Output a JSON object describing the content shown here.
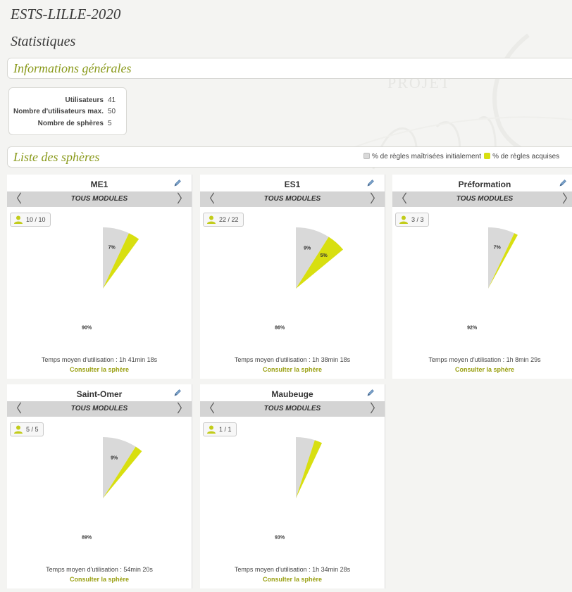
{
  "app_title": "ESTS-LILLE-2020",
  "page_title": "Statistiques",
  "general": {
    "title": "Informations générales",
    "rows": [
      {
        "label": "Utilisateurs",
        "value": "41"
      },
      {
        "label": "Nombre d'utilisateurs max.",
        "value": "50"
      },
      {
        "label": "Nombre de sphères",
        "value": "5"
      }
    ]
  },
  "spheres_section": {
    "title": "Liste des sphères",
    "legend": {
      "initial_label": "% de règles maîtrisées initialement",
      "acquired_label": "% de règles acquises"
    }
  },
  "colors": {
    "initial": "#d9d9d9",
    "acquired": "#d8df10",
    "remaining": "#ffffff",
    "accent": "#8a9a1c"
  },
  "watermark": {
    "text": "PROJET"
  },
  "icons": {
    "edit": "pencil-icon",
    "users": "user-icon",
    "prev": "chevron-left-icon",
    "next": "chevron-right-icon"
  },
  "cards": [
    {
      "name": "ME1",
      "module": "TOUS MODULES",
      "users": "10 / 10",
      "initial_pct": 7,
      "acquired_pct": 3,
      "labels": {
        "initial": "7%",
        "acquired": "",
        "remaining": "90%"
      },
      "usage": "Temps moyen d'utilisation : 1h 41min 18s",
      "consult": "Consulter la sphère"
    },
    {
      "name": "ES1",
      "module": "TOUS MODULES",
      "users": "22 / 22",
      "initial_pct": 9,
      "acquired_pct": 5,
      "labels": {
        "initial": "9%",
        "acquired": "5%",
        "remaining": "86%"
      },
      "usage": "Temps moyen d'utilisation : 1h 38min 18s",
      "consult": "Consulter la sphère"
    },
    {
      "name": "Préformation",
      "module": "TOUS MODULES",
      "users": "3 / 3",
      "initial_pct": 7,
      "acquired_pct": 1,
      "labels": {
        "initial": "7%",
        "acquired": "",
        "remaining": "92%"
      },
      "usage": "Temps moyen d'utilisation : 1h 8min 29s",
      "consult": "Consulter la sphère"
    },
    {
      "name": "Saint-Omer",
      "module": "TOUS MODULES",
      "users": "5 / 5",
      "initial_pct": 9,
      "acquired_pct": 2,
      "labels": {
        "initial": "9%",
        "acquired": "",
        "remaining": "89%"
      },
      "usage": "Temps moyen d'utilisation : 54min 20s",
      "consult": "Consulter la sphère"
    },
    {
      "name": "Maubeuge",
      "module": "TOUS MODULES",
      "users": "1 / 1",
      "initial_pct": 5,
      "acquired_pct": 2,
      "labels": {
        "initial": "",
        "acquired": "",
        "remaining": "93%"
      },
      "usage": "Temps moyen d'utilisation : 1h 34min 28s",
      "consult": "Consulter la sphère"
    }
  ]
}
